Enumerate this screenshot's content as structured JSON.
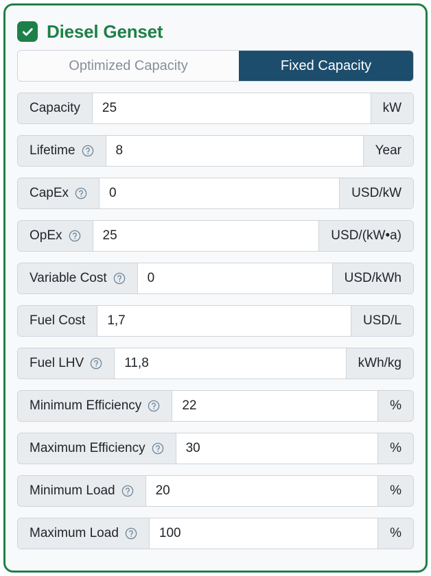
{
  "card": {
    "enabled": true,
    "title": "Diesel Genset",
    "accent_green": "#1d8049",
    "accent_navy": "#1d4d6d"
  },
  "capacity_mode": {
    "options": [
      "Optimized Capacity",
      "Fixed Capacity"
    ],
    "optimized_label": "Optimized Capacity",
    "fixed_label": "Fixed Capacity",
    "selected": "Fixed Capacity"
  },
  "fields": [
    {
      "label": "Capacity",
      "help": false,
      "value": "25",
      "unit": "kW",
      "placeholder": ""
    },
    {
      "label": "Lifetime",
      "help": true,
      "value": "8",
      "unit": "Year",
      "placeholder": ""
    },
    {
      "label": "CapEx",
      "help": true,
      "value": "0",
      "unit": "USD/kW",
      "placeholder": ""
    },
    {
      "label": "OpEx",
      "help": true,
      "value": "25",
      "unit": "USD/(kW•a)",
      "placeholder": ""
    },
    {
      "label": "Variable Cost",
      "help": true,
      "value": "0",
      "unit": "USD/kWh",
      "placeholder": ""
    },
    {
      "label": "Fuel Cost",
      "help": false,
      "value": "1,7",
      "unit": "USD/L",
      "placeholder": ""
    },
    {
      "label": "Fuel LHV",
      "help": true,
      "value": "11,8",
      "unit": "kWh/kg",
      "placeholder": ""
    },
    {
      "label": "Minimum Efficiency",
      "help": true,
      "value": "22",
      "unit": "%",
      "placeholder": ""
    },
    {
      "label": "Maximum Efficiency",
      "help": true,
      "value": "30",
      "unit": "%",
      "placeholder": ""
    },
    {
      "label": "Minimum Load",
      "help": true,
      "value": "20",
      "unit": "%",
      "placeholder": ""
    },
    {
      "label": "Maximum Load",
      "help": true,
      "value": "100",
      "unit": "%",
      "placeholder": ""
    }
  ],
  "icons": {
    "checkbox": "check-icon",
    "help": "help-circle-icon"
  }
}
